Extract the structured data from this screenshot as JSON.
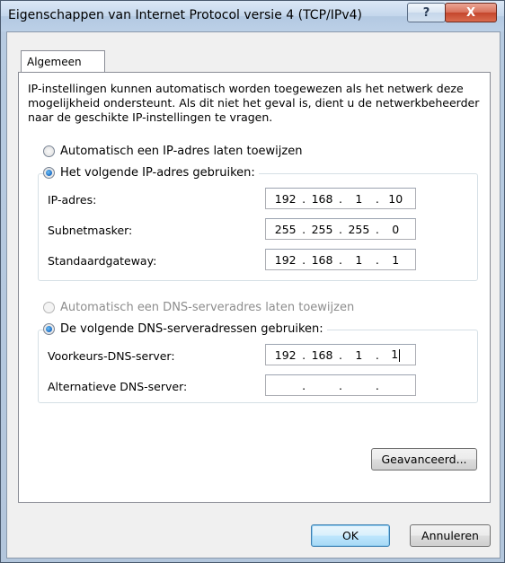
{
  "window": {
    "title": "Eigenschappen van Internet Protocol versie 4 (TCP/IPv4)",
    "help_label": "?",
    "close_label": "X"
  },
  "tabs": [
    {
      "label": "Algemeen"
    }
  ],
  "intro_text": "IP-instellingen kunnen automatisch worden toegewezen als het netwerk deze mogelijkheid ondersteunt. Als dit niet het geval is, dient u de netwerkbeheerder naar de geschikte IP-instellingen te vragen.",
  "ip": {
    "auto_label": "Automatisch een IP-adres laten toewijzen",
    "auto_selected": false,
    "manual_label": "Het volgende IP-adres gebruiken:",
    "manual_selected": true,
    "fields": [
      {
        "label": "IP-adres:",
        "octets": [
          "192",
          "168",
          "1",
          "10"
        ]
      },
      {
        "label": "Subnetmasker:",
        "octets": [
          "255",
          "255",
          "255",
          "0"
        ]
      },
      {
        "label": "Standaardgateway:",
        "octets": [
          "192",
          "168",
          "1",
          "1"
        ]
      }
    ]
  },
  "dns": {
    "auto_label": "Automatisch een DNS-serveradres laten toewijzen",
    "auto_enabled": false,
    "manual_label": "De volgende DNS-serveradressen gebruiken:",
    "manual_selected": true,
    "fields": [
      {
        "label": "Voorkeurs-DNS-server:",
        "octets": [
          "192",
          "168",
          "1",
          "1"
        ]
      },
      {
        "label": "Alternatieve DNS-server:",
        "octets": [
          "",
          "",
          "",
          ""
        ]
      }
    ]
  },
  "buttons": {
    "advanced": "Geavanceerd...",
    "ok": "OK",
    "cancel": "Annuleren"
  },
  "ip_separator": "."
}
